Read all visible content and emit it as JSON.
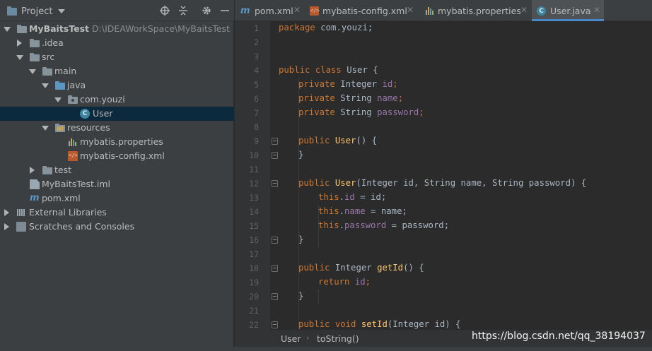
{
  "panel": {
    "title": "Project",
    "header_icons": [
      "crosshair-icon",
      "collapse-icon",
      "gear-icon",
      "minimize-icon"
    ]
  },
  "tree": {
    "root": {
      "label": "MyBaitsTest",
      "path": "D:\\IDEAWorkSpace\\MyBaitsTest"
    },
    "idea": ".idea",
    "src": "src",
    "main": "main",
    "java": "java",
    "package": "com.youzi",
    "user": "User",
    "resources": "resources",
    "props": "mybatis.properties",
    "config": "mybatis-config.xml",
    "test": "test",
    "iml": "MyBaitsTest.iml",
    "pom": "pom.xml",
    "libs": "External Libraries",
    "scratches": "Scratches and Consoles"
  },
  "tabs": [
    {
      "label": "pom.xml"
    },
    {
      "label": "mybatis-config.xml"
    },
    {
      "label": "mybatis.properties"
    },
    {
      "label": "User.java"
    }
  ],
  "line_numbers": [
    "1",
    "2",
    "3",
    "4",
    "5",
    "6",
    "7",
    "8",
    "9",
    "10",
    "11",
    "12",
    "13",
    "14",
    "15",
    "16",
    "17",
    "18",
    "19",
    "20",
    "21",
    "22"
  ],
  "code": {
    "l1_k": "package",
    "l1_t": " com.youzi;",
    "l4_k": "public class",
    "l4_t": " User {",
    "l5_k": "private",
    "l5_t": " Integer ",
    "l5_f": "id",
    "l5_e": ";",
    "l6_k": "private",
    "l6_t": " String ",
    "l6_f": "name",
    "l6_e": ";",
    "l7_k": "private",
    "l7_t": " String ",
    "l7_f": "password",
    "l7_e": ";",
    "l9_k": "public",
    "l9_m": " User",
    "l9_t": "() {",
    "l10_t": "}",
    "l12_k": "public",
    "l12_m": " User",
    "l12_t": "(Integer id, String name, String password) {",
    "l13_k": "this",
    "l13_p": ".",
    "l13_f": "id",
    "l13_t": " = id;",
    "l14_k": "this",
    "l14_p": ".",
    "l14_f": "name",
    "l14_t": " = name;",
    "l15_k": "this",
    "l15_p": ".",
    "l15_f": "password",
    "l15_t": " = password;",
    "l16_t": "}",
    "l18_k": "public",
    "l18_t": " Integer ",
    "l18_m": "getId",
    "l18_e": "() {",
    "l19_k": "return",
    "l19_f": " id",
    "l19_e": ";",
    "l20_t": "}",
    "l22_k": "public void",
    "l22_m": " setId",
    "l22_t": "(Integer id) {"
  },
  "breadcrumbs": [
    "User",
    "toString()"
  ],
  "watermark": "https://blog.csdn.net/qq_38194037",
  "colors": {
    "keyword": "#cc7832",
    "field": "#9876aa",
    "method": "#ffc66d",
    "selection": "#0d293e",
    "active_tab_underline": "#4a88c7"
  }
}
